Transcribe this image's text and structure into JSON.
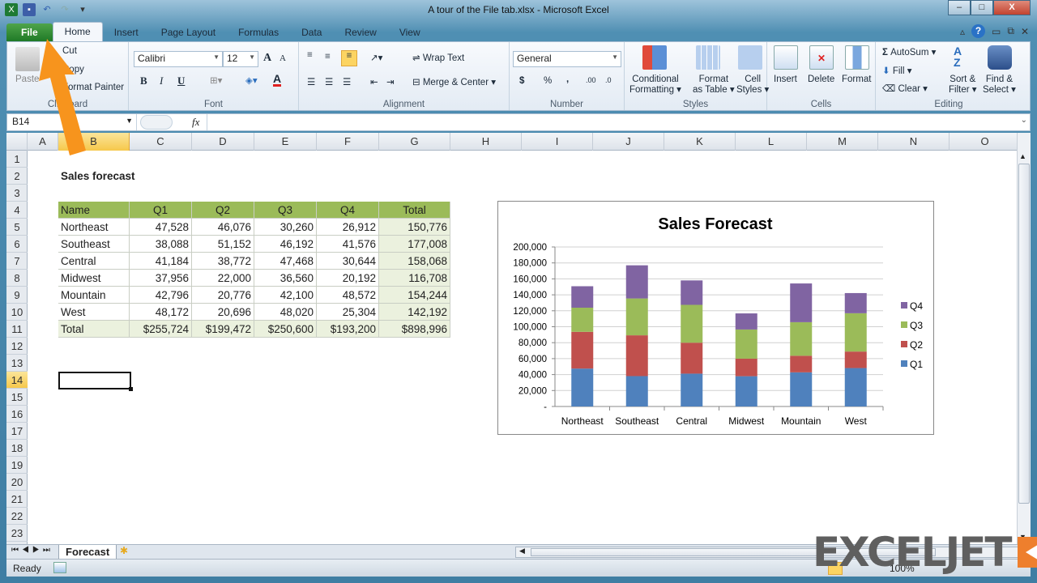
{
  "window": {
    "title": "A tour of the File tab.xlsx - Microsoft Excel",
    "minimize": "–",
    "maximize": "□",
    "close": "X"
  },
  "quick_access": [
    "excel-logo",
    "save-icon",
    "undo-icon",
    "redo-icon",
    "customize-icon"
  ],
  "tabs": [
    {
      "label": "File",
      "active": false
    },
    {
      "label": "Home",
      "active": true
    },
    {
      "label": "Insert"
    },
    {
      "label": "Page Layout"
    },
    {
      "label": "Formulas"
    },
    {
      "label": "Data"
    },
    {
      "label": "Review"
    },
    {
      "label": "View"
    }
  ],
  "ribbon": {
    "clipboard": {
      "label": "Clipboard",
      "paste": "Paste",
      "cut": "Cut",
      "copy": "Copy",
      "format_painter": "Format Painter"
    },
    "font": {
      "label": "Font",
      "name": "Calibri",
      "size": "12",
      "bold": "B",
      "italic": "I",
      "underline": "U",
      "grow": "A",
      "shrink": "A",
      "font_color": "A"
    },
    "alignment": {
      "label": "Alignment",
      "wrap_text": "Wrap Text",
      "merge_center": "Merge & Center"
    },
    "number": {
      "label": "Number",
      "format": "General",
      "currency": "$",
      "percent": "%",
      "comma": ",",
      "inc_decimal": ".00",
      "dec_decimal": ".0"
    },
    "styles": {
      "label": "Styles",
      "conditional": "Conditional",
      "conditional2": "Formatting",
      "format_table": "Format",
      "format_table2": "as Table",
      "cell_styles": "Cell",
      "cell_styles2": "Styles"
    },
    "cells": {
      "label": "Cells",
      "insert": "Insert",
      "delete": "Delete",
      "format": "Format"
    },
    "editing": {
      "label": "Editing",
      "autosum": "AutoSum",
      "fill": "Fill",
      "clear": "Clear",
      "sort": "Sort &",
      "sort2": "Filter",
      "find": "Find &",
      "find2": "Select"
    }
  },
  "formula_bar": {
    "name_box": "B14",
    "fx": "fx",
    "value": ""
  },
  "columns": [
    "A",
    "B",
    "C",
    "D",
    "E",
    "F",
    "G",
    "H",
    "I",
    "J",
    "K",
    "L",
    "M",
    "N",
    "O"
  ],
  "rows": [
    "1",
    "2",
    "3",
    "4",
    "5",
    "6",
    "7",
    "8",
    "9",
    "10",
    "11",
    "12",
    "13",
    "14",
    "15",
    "16",
    "17",
    "18",
    "19",
    "20",
    "21",
    "22",
    "23"
  ],
  "selected": {
    "column": "B",
    "row": "14"
  },
  "sheet_title": "Sales forecast",
  "table": {
    "headers": [
      "Name",
      "Q1",
      "Q2",
      "Q3",
      "Q4",
      "Total"
    ],
    "rows": [
      [
        "Northeast",
        "47,528",
        "46,076",
        "30,260",
        "26,912",
        "150,776"
      ],
      [
        "Southeast",
        "38,088",
        "51,152",
        "46,192",
        "41,576",
        "177,008"
      ],
      [
        "Central",
        "41,184",
        "38,772",
        "47,468",
        "30,644",
        "158,068"
      ],
      [
        "Midwest",
        "37,956",
        "22,000",
        "36,560",
        "20,192",
        "116,708"
      ],
      [
        "Mountain",
        "42,796",
        "20,776",
        "42,100",
        "48,572",
        "154,244"
      ],
      [
        "West",
        "48,172",
        "20,696",
        "48,020",
        "25,304",
        "142,192"
      ]
    ],
    "total": [
      "Total",
      "$255,724",
      "$199,472",
      "$250,600",
      "$193,200",
      "$898,996"
    ]
  },
  "chart_data": {
    "type": "bar",
    "stacked": true,
    "title": "Sales Forecast",
    "categories": [
      "Northeast",
      "Southeast",
      "Central",
      "Midwest",
      "Mountain",
      "West"
    ],
    "series": [
      {
        "name": "Q1",
        "color": "#4f81bd",
        "values": [
          47528,
          38088,
          41184,
          37956,
          42796,
          48172
        ]
      },
      {
        "name": "Q2",
        "color": "#c0504d",
        "values": [
          46076,
          51152,
          38772,
          22000,
          20776,
          20696
        ]
      },
      {
        "name": "Q3",
        "color": "#9bbb59",
        "values": [
          30260,
          46192,
          47468,
          36560,
          42100,
          48020
        ]
      },
      {
        "name": "Q4",
        "color": "#8064a2",
        "values": [
          26912,
          41576,
          30644,
          20192,
          48572,
          25304
        ]
      }
    ],
    "yticks": [
      "-",
      "20,000",
      "40,000",
      "60,000",
      "80,000",
      "100,000",
      "120,000",
      "140,000",
      "160,000",
      "180,000",
      "200,000"
    ],
    "ylim": [
      0,
      200000
    ],
    "xlabel": "",
    "ylabel": "",
    "grid": true,
    "legend": "right"
  },
  "sheet_tabs": [
    {
      "label": "Forecast",
      "active": true
    }
  ],
  "status": {
    "ready": "Ready",
    "zoom": "100%"
  },
  "watermark": "EXCELJET",
  "colors": {
    "header_green": "#9bbb59",
    "total_fill": "#ebf1de",
    "file_tab": "#2e8b36",
    "arrow": "#f7941d"
  }
}
